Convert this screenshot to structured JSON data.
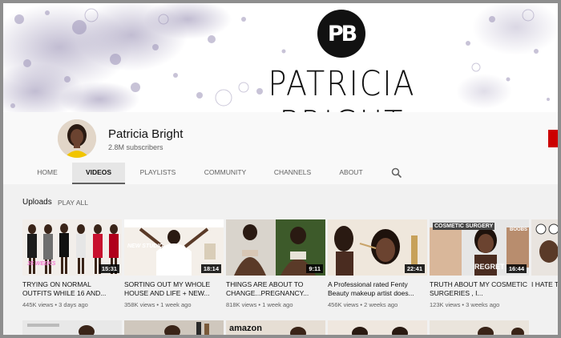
{
  "banner": {
    "logo_text": "PB",
    "title": "PATRICIA  BRIGHT"
  },
  "channel": {
    "name": "Patricia Bright",
    "subscribers": "2.8M subscribers"
  },
  "tabs": [
    {
      "label": "HOME"
    },
    {
      "label": "VIDEOS"
    },
    {
      "label": "PLAYLISTS"
    },
    {
      "label": "COMMUNITY"
    },
    {
      "label": "CHANNELS"
    },
    {
      "label": "ABOUT"
    }
  ],
  "uploads": {
    "label": "Uploads",
    "play_all": "PLAY ALL"
  },
  "videos": [
    {
      "title": "TRYING ON NORMAL OUTFITS WHILE 16 AND...",
      "meta": "445K views • 3 days ago",
      "duration": "15:31",
      "thumb_text": "35 WEEKS"
    },
    {
      "title": "SORTING OUT MY WHOLE HOUSE AND LIFE + NEW...",
      "meta": "358K views • 1 week ago",
      "duration": "18:14",
      "thumb_text": "NEW STUDIO"
    },
    {
      "title": "THINGS ARE ABOUT TO CHANGE...PREGNANCY...",
      "meta": "818K views • 1 week ago",
      "duration": "9:11",
      "thumb_text": ""
    },
    {
      "title": "A Professional rated Fenty Beauty makeup artist does...",
      "meta": "456K views • 2 weeks ago",
      "duration": "22:41",
      "thumb_text": ""
    },
    {
      "title": "TRUTH ABOUT MY COSMETIC SURGERIES , I...",
      "meta": "123K views • 3 weeks ago",
      "duration": "16:44",
      "thumb_text": "COSMETIC SURGERY",
      "thumb_text2": "REGRET",
      "thumb_text3": "BOOBS"
    },
    {
      "title": "I HATE T... BEING...",
      "meta": "",
      "duration": "",
      "thumb_text": ""
    }
  ],
  "colors": {
    "accent_red": "#cc0000",
    "text_primary": "#111111",
    "text_secondary": "#606060"
  }
}
